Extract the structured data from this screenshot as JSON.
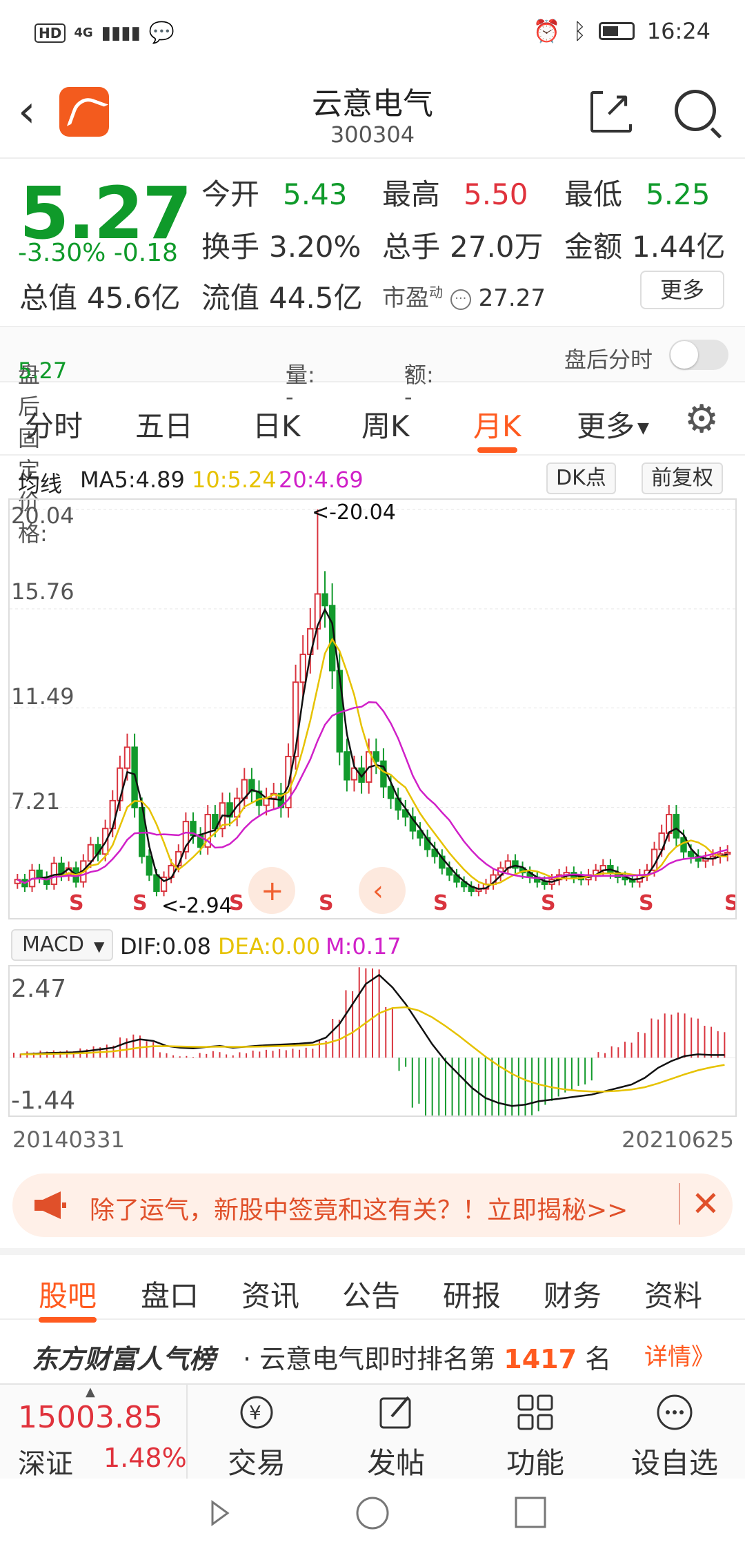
{
  "status": {
    "network": "4G",
    "time": "16:24",
    "badge": "HD"
  },
  "header": {
    "name": "云意电气",
    "code": "300304"
  },
  "quote": {
    "price": "5.27",
    "change_pct": "-3.30%",
    "change": "-0.18",
    "rows": [
      [
        {
          "l": "今开",
          "v": "5.43",
          "c": "green"
        },
        {
          "l": "最高",
          "v": "5.50",
          "c": "red"
        },
        {
          "l": "最低",
          "v": "5.25",
          "c": "green"
        }
      ],
      [
        {
          "l": "换手",
          "v": "3.20%",
          "c": "black"
        },
        {
          "l": "总手",
          "v": "27.0万",
          "c": "black"
        },
        {
          "l": "金额",
          "v": "1.44亿",
          "c": "black"
        }
      ]
    ],
    "total_value_label": "总值",
    "total_value": "45.6亿",
    "float_value_label": "流值",
    "float_value": "44.5亿",
    "pe_label": "市盈",
    "pe_super": "动",
    "pe": "27.27",
    "more": "更多"
  },
  "after_hours": {
    "price_label": "盘后固定价格:",
    "price": "5.27",
    "vol_label": "量:",
    "vol": "--",
    "amt_label": "额:",
    "amt": "--",
    "minute_label": "盘后分时"
  },
  "period_tabs": [
    "分时",
    "五日",
    "日K",
    "周K",
    "月K",
    "更多"
  ],
  "active_period": 4,
  "ma": {
    "label": "均线",
    "ma5": "MA5:4.89",
    "ma10": "10:5.24",
    "ma20": "20:4.69",
    "dk": "DK点",
    "adjust": "前复权"
  },
  "kchart": {
    "y_labels": [
      "20.04",
      "15.76",
      "11.49",
      "7.21"
    ],
    "max_label": "<-20.04",
    "min_label": "<-2.94",
    "s_marks": 8
  },
  "macd": {
    "select": "MACD",
    "dif": "DIF:0.08",
    "dea": "DEA:0.00",
    "m": "M:0.17",
    "top": "2.47",
    "bottom": "-1.44"
  },
  "dates": {
    "start": "20140331",
    "end": "20210625"
  },
  "ad": {
    "text": "除了运气，新股中签竟和这有关？！立即揭秘>>"
  },
  "content_tabs": [
    "股吧",
    "盘口",
    "资讯",
    "公告",
    "研报",
    "财务",
    "资料"
  ],
  "active_content": 0,
  "rank": {
    "brand": "东方财富人气榜",
    "prefix": "· 云意电气即时排名第",
    "num": "1417",
    "suffix": "名",
    "detail": "详情》"
  },
  "index": {
    "value": "15003.85",
    "name": "深证",
    "pct": "1.48%"
  },
  "tools": [
    "交易",
    "发帖",
    "功能",
    "设自选"
  ],
  "colors": {
    "up": "#e0323c",
    "down": "#0f9a2a",
    "accent": "#ff5a1f",
    "ma10": "#e6c200",
    "ma20": "#d020c8"
  },
  "chart_data": {
    "type": "candlestick",
    "y_range": [
      2.94,
      20.04
    ],
    "closes": [
      4.1,
      3.8,
      4.5,
      4.2,
      3.9,
      4.8,
      4.3,
      4.6,
      4.0,
      4.9,
      5.6,
      5.2,
      6.3,
      7.5,
      8.9,
      9.8,
      7.2,
      5.1,
      4.3,
      3.6,
      4.2,
      4.7,
      5.3,
      6.6,
      6.0,
      5.5,
      6.9,
      6.3,
      7.4,
      6.8,
      7.6,
      8.4,
      7.9,
      7.3,
      7.6,
      7.8,
      7.2,
      9.4,
      12.6,
      13.8,
      14.9,
      16.4,
      15.9,
      13.1,
      9.6,
      8.4,
      8.9,
      8.3,
      9.6,
      9.2,
      8.1,
      7.6,
      7.1,
      6.8,
      6.2,
      5.9,
      5.4,
      5.1,
      4.6,
      4.3,
      4.0,
      3.8,
      3.6,
      3.7,
      3.9,
      4.3,
      4.6,
      4.9,
      4.6,
      4.4,
      4.2,
      4.0,
      3.9,
      4.1,
      4.3,
      4.4,
      4.2,
      4.1,
      4.3,
      4.5,
      4.7,
      4.4,
      4.2,
      4.1,
      4.0,
      4.3,
      4.5,
      5.4,
      6.1,
      6.9,
      5.9,
      5.3,
      5.1,
      4.9,
      5.0,
      5.1,
      5.2,
      5.27
    ],
    "macd_dif": [
      0.1,
      0.12,
      0.14,
      0.15,
      0.16,
      0.2,
      0.25,
      0.3,
      0.45,
      0.55,
      0.5,
      0.35,
      0.3,
      0.28,
      0.32,
      0.35,
      0.3,
      0.33,
      0.36,
      0.38,
      0.4,
      0.42,
      0.45,
      0.6,
      1.0,
      1.6,
      2.2,
      2.47,
      2.1,
      1.6,
      1.0,
      0.4,
      -0.1,
      -0.5,
      -0.9,
      -1.2,
      -1.35,
      -1.44,
      -1.4,
      -1.3,
      -1.25,
      -1.2,
      -1.15,
      -1.1,
      -1.0,
      -0.9,
      -0.8,
      -0.6,
      -0.3,
      -0.1,
      0.05,
      0.1,
      0.08,
      0.08
    ]
  }
}
